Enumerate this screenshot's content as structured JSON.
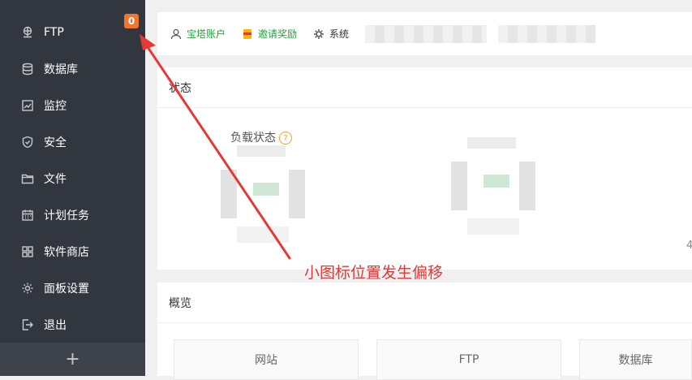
{
  "sidebar": {
    "items": [
      {
        "label": "FTP",
        "icon": "network-icon"
      },
      {
        "label": "数据库",
        "icon": "database-icon"
      },
      {
        "label": "监控",
        "icon": "monitor-icon"
      },
      {
        "label": "安全",
        "icon": "shield-icon"
      },
      {
        "label": "文件",
        "icon": "folder-icon"
      },
      {
        "label": "计划任务",
        "icon": "calendar-icon"
      },
      {
        "label": "软件商店",
        "icon": "grid-icon"
      },
      {
        "label": "面板设置",
        "icon": "gear-icon"
      },
      {
        "label": "退出",
        "icon": "logout-icon"
      }
    ],
    "ftp_badge": "0",
    "add_label": "+"
  },
  "header": {
    "account": "宝塔账户",
    "invite": "邀请奖励",
    "system": "系统"
  },
  "status": {
    "title": "状态",
    "load_label": "负载状态",
    "help": "?",
    "edge_char": "4"
  },
  "overview": {
    "title": "概览",
    "cards": [
      "网站",
      "FTP",
      "数据库"
    ]
  },
  "annotation": {
    "text": "小图标位置发生偏移",
    "color": "#e53935"
  },
  "colors": {
    "sidebar_bg": "#32363f",
    "accent_green": "#20a53a",
    "badge": "#f0752e"
  }
}
